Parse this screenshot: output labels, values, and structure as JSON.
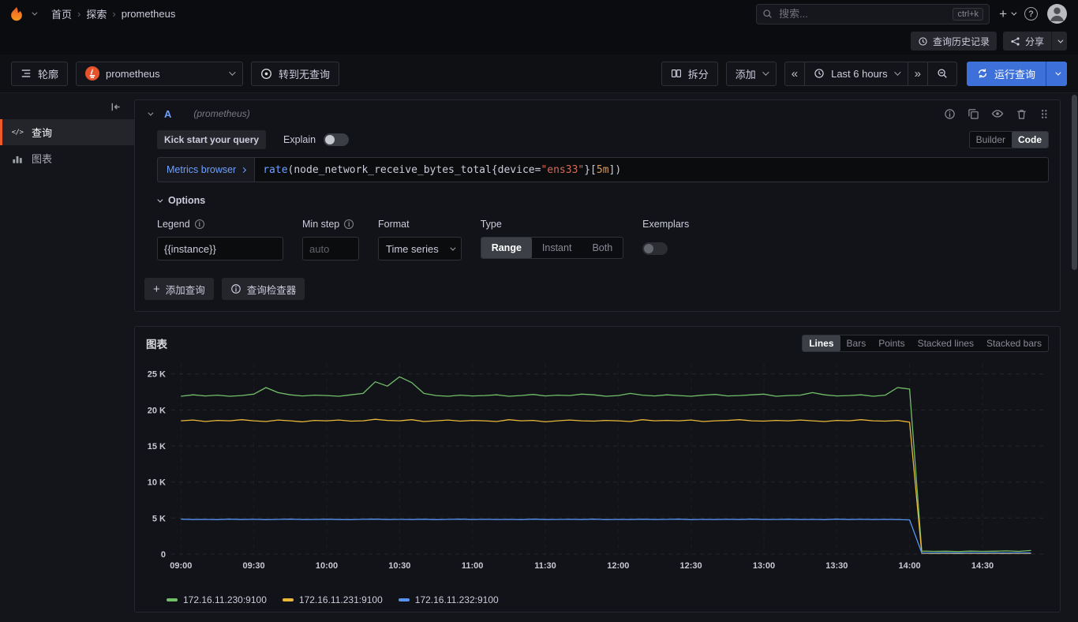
{
  "icons": {
    "plus": "+",
    "help": "?",
    "shift_back": "«",
    "shift_forward": "»",
    "breadcrumb_sep": "›",
    "code": "</>"
  },
  "topnav": {
    "breadcrumb": {
      "home": "首页",
      "section": "探索",
      "page": "prometheus"
    },
    "search": {
      "placeholder": "搜索...",
      "shortcut": "ctrl+k"
    }
  },
  "subnav": {
    "history_label": "查询历史记录",
    "share_label": "分享"
  },
  "toolbar": {
    "outline_label": "轮廓",
    "datasource_name": "prometheus",
    "queryless_label": "转到无查询",
    "split_label": "拆分",
    "add_label": "添加",
    "time_range_label": "Last 6 hours",
    "run_query_label": "运行查询"
  },
  "sidebar": {
    "items": [
      {
        "label": "查询"
      },
      {
        "label": "图表"
      }
    ]
  },
  "query_editor": {
    "ref_id": "A",
    "datasource_hint": "(prometheus)",
    "kick_start_label": "Kick start your query",
    "explain_label": "Explain",
    "mode_options": [
      "Builder",
      "Code"
    ],
    "mode_selected": "Code",
    "metrics_browser_label": "Metrics browser",
    "expr_text": "rate(node_network_receive_bytes_total{device=\"ens33\"}[5m])",
    "expr_tokens": [
      {
        "text": "rate",
        "type": "fn"
      },
      {
        "text": "(node_network_receive_bytes_total{device=",
        "type": "plain"
      },
      {
        "text": "\"ens33\"",
        "type": "str"
      },
      {
        "text": "}[",
        "type": "plain"
      },
      {
        "text": "5m",
        "type": "dur"
      },
      {
        "text": "])",
        "type": "plain"
      }
    ],
    "options": {
      "title": "Options",
      "legend_label": "Legend",
      "legend_value": "{{instance}}",
      "min_step_label": "Min step",
      "min_step_placeholder": "auto",
      "format_label": "Format",
      "format_value": "Time series",
      "type_label": "Type",
      "type_options": [
        "Range",
        "Instant",
        "Both"
      ],
      "type_selected": "Range",
      "exemplars_label": "Exemplars"
    },
    "add_query_label": "添加查询",
    "inspector_label": "查询检查器"
  },
  "graph_panel": {
    "title": "图表",
    "viz_options": [
      "Lines",
      "Bars",
      "Points",
      "Stacked lines",
      "Stacked bars"
    ],
    "viz_selected": "Lines"
  },
  "chart_data": {
    "type": "line",
    "title": "图表",
    "x_axis": "time",
    "x_start_min": 540,
    "x_step_min": 5,
    "x_domain_min": [
      536,
      896
    ],
    "ylim": [
      0,
      26500
    ],
    "grid": true,
    "legend_position": "bottom",
    "x_ticks": [
      {
        "min": 540,
        "label": "09:00"
      },
      {
        "min": 570,
        "label": "09:30"
      },
      {
        "min": 600,
        "label": "10:00"
      },
      {
        "min": 630,
        "label": "10:30"
      },
      {
        "min": 660,
        "label": "11:00"
      },
      {
        "min": 690,
        "label": "11:30"
      },
      {
        "min": 720,
        "label": "12:00"
      },
      {
        "min": 750,
        "label": "12:30"
      },
      {
        "min": 780,
        "label": "13:00"
      },
      {
        "min": 810,
        "label": "13:30"
      },
      {
        "min": 840,
        "label": "14:00"
      },
      {
        "min": 870,
        "label": "14:30"
      }
    ],
    "y_ticks": [
      {
        "v": 0,
        "label": "0"
      },
      {
        "v": 5000,
        "label": "5 K"
      },
      {
        "v": 10000,
        "label": "10 K"
      },
      {
        "v": 15000,
        "label": "15 K"
      },
      {
        "v": 20000,
        "label": "20 K"
      },
      {
        "v": 25000,
        "label": "25 K"
      }
    ],
    "series": [
      {
        "name": "172.16.11.230:9100",
        "color": "#73bf69",
        "values": [
          21900,
          22100,
          21950,
          22050,
          21900,
          22000,
          22200,
          23100,
          22400,
          22100,
          21950,
          22050,
          22000,
          21900,
          22100,
          22300,
          23900,
          23300,
          24600,
          23800,
          22300,
          22000,
          21900,
          22050,
          21950,
          22000,
          22100,
          21900,
          22000,
          22150,
          21950,
          22050,
          22000,
          22200,
          22100,
          21900,
          22000,
          22300,
          22050,
          21950,
          22100,
          22000,
          21900,
          22050,
          22150,
          21950,
          22000,
          22100,
          22200,
          21900,
          22000,
          22050,
          22400,
          22100,
          21950,
          22000,
          22100,
          21900,
          22050,
          23100,
          22900,
          420,
          380,
          400,
          350,
          420,
          380,
          400,
          450,
          380,
          500
        ]
      },
      {
        "name": "172.16.11.231:9100",
        "color": "#eab839",
        "values": [
          18500,
          18600,
          18400,
          18550,
          18500,
          18650,
          18500,
          18400,
          18600,
          18500,
          18350,
          18550,
          18500,
          18600,
          18450,
          18500,
          18700,
          18550,
          18500,
          18650,
          18400,
          18500,
          18600,
          18450,
          18550,
          18500,
          18400,
          18650,
          18500,
          18550,
          18350,
          18500,
          18600,
          18500,
          18450,
          18550,
          18500,
          18400,
          18650,
          18500,
          18550,
          18500,
          18600,
          18400,
          18500,
          18550,
          18650,
          18500,
          18450,
          18550,
          18500,
          18600,
          18500,
          18400,
          18550,
          18500,
          18650,
          18500,
          18450,
          18550,
          18300,
          120,
          100,
          110,
          90,
          120,
          100,
          110,
          100,
          120,
          100
        ]
      },
      {
        "name": "172.16.11.232:9100",
        "color": "#5794f2",
        "values": [
          4850,
          4800,
          4820,
          4780,
          4850,
          4800,
          4830,
          4790,
          4820,
          4850,
          4800,
          4810,
          4840,
          4800,
          4780,
          4830,
          4850,
          4800,
          4820,
          4800,
          4840,
          4790,
          4820,
          4850,
          4800,
          4830,
          4800,
          4820,
          4780,
          4850,
          4800,
          4810,
          4830,
          4800,
          4850,
          4790,
          4820,
          4800,
          4840,
          4800,
          4820,
          4850,
          4780,
          4820,
          4800,
          4830,
          4800,
          4850,
          4800,
          4810,
          4840,
          4800,
          4820,
          4780,
          4850,
          4800,
          4830,
          4800,
          4820,
          4800,
          4750,
          180,
          160,
          170,
          150,
          180,
          160,
          170,
          160,
          180,
          160
        ]
      }
    ]
  }
}
